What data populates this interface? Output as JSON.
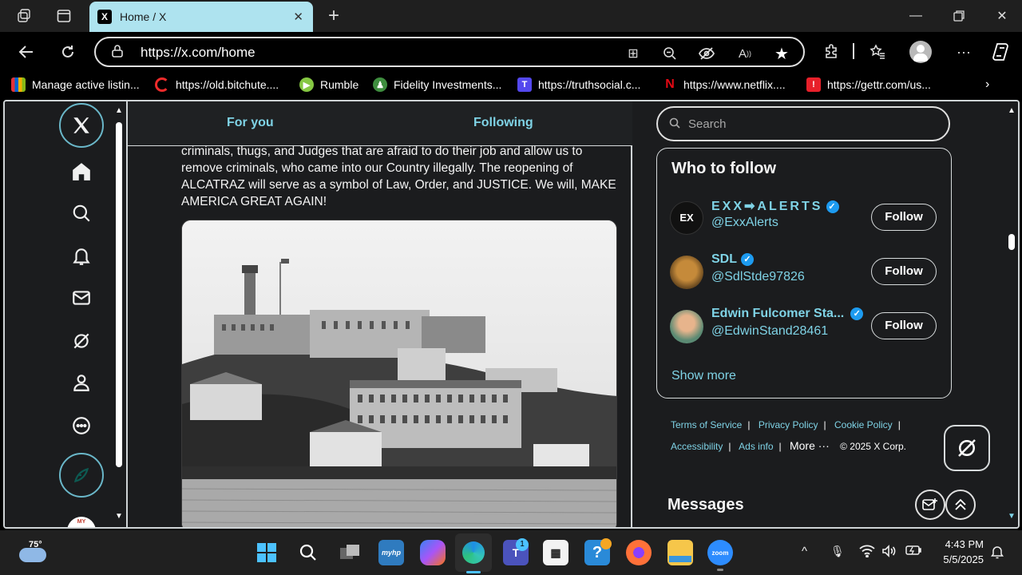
{
  "browser": {
    "tab_title": "Home / X",
    "tab_favicon": "X",
    "url": "https://x.com/home",
    "favorites": [
      {
        "label": "Manage active listin...",
        "icon": "ebay-icon",
        "color": "#e53238"
      },
      {
        "label": "https://old.bitchute....",
        "icon": "bitchute-icon",
        "color": "#ef2b2b"
      },
      {
        "label": "Rumble",
        "icon": "rumble-icon",
        "color": "#85c742"
      },
      {
        "label": "Fidelity Investments...",
        "icon": "fidelity-icon",
        "color": "#3e8d3e"
      },
      {
        "label": "https://truthsocial.c...",
        "icon": "truthsocial-icon",
        "color": "#5448ee"
      },
      {
        "label": "https://www.netflix....",
        "icon": "netflix-icon",
        "color": "#e50914"
      },
      {
        "label": "https://gettr.com/us...",
        "icon": "gettr-icon",
        "color": "#e8202a"
      }
    ]
  },
  "x": {
    "feed_tabs": [
      "For you",
      "Following"
    ],
    "tweet_text": "criminals, thugs, and Judges that are afraid to do their job and allow us to remove criminals, who came into our Country illegally. The reopening of ALCATRAZ will serve as a symbol of Law, Order, and JUSTICE. We will, MAKE AMERICA GREAT AGAIN!",
    "search_placeholder": "Search",
    "who_to_follow": {
      "title": "Who to follow",
      "users": [
        {
          "name": "EXX➡ALERTS",
          "handle": "@ExxAlerts",
          "button": "Follow"
        },
        {
          "name": "SDL",
          "handle": "@SdlStde97826",
          "button": "Follow"
        },
        {
          "name": "Edwin Fulcomer Sta...",
          "handle": "@EdwinStand28461",
          "button": "Follow"
        }
      ],
      "show_more": "Show more"
    },
    "footer": {
      "links": [
        "Terms of Service",
        "Privacy Policy",
        "Cookie Policy",
        "Accessibility",
        "Ads info",
        "More ···"
      ],
      "copyright": "© 2025 X Corp."
    },
    "messages_title": "Messages"
  },
  "taskbar": {
    "weather": "75°",
    "time": "4:43 PM",
    "date": "5/5/2025",
    "teams_badge": "1"
  },
  "colors": {
    "accent": "#7fd3e6",
    "verified": "#1d9bf0",
    "tab_active": "#aee3ef"
  }
}
